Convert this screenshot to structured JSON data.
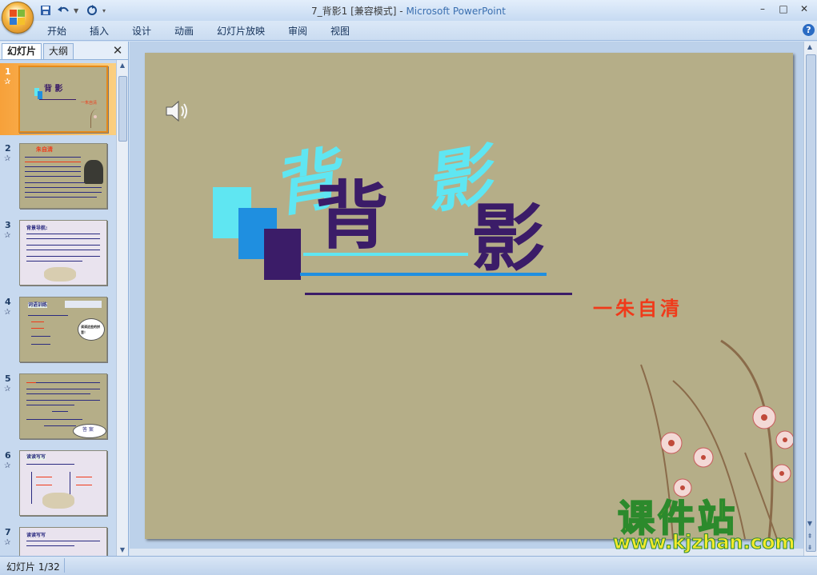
{
  "window": {
    "title_doc": "7_背影1 [兼容模式] - ",
    "title_app": "Microsoft PowerPoint",
    "controls": {
      "minimize": "–",
      "maximize": "□",
      "close": "✕"
    }
  },
  "quick_access": {
    "save_icon": "save-icon",
    "undo_icon": "undo-icon",
    "redo_icon": "redo-icon"
  },
  "ribbon": {
    "tabs": [
      "开始",
      "插入",
      "设计",
      "动画",
      "幻灯片放映",
      "审阅",
      "视图"
    ],
    "help": "?"
  },
  "left_pane": {
    "tabs": {
      "slides": "幻灯片",
      "outline": "大纲"
    },
    "close": "✕",
    "thumbnails": [
      {
        "num": "1"
      },
      {
        "num": "2"
      },
      {
        "num": "3"
      },
      {
        "num": "4"
      },
      {
        "num": "5"
      },
      {
        "num": "6"
      },
      {
        "num": "7"
      }
    ],
    "thumb_text": {
      "t1_title": "背 影",
      "t1_author": "一朱自清",
      "t2_title": "朱自清",
      "t3_title": "背景导航:",
      "t4_title": "词语训练",
      "t4_bubble": "读读这些的拼音！",
      "t5_bubble": "答 案",
      "t6_title": "读读写写",
      "t7_title": "读读写写"
    }
  },
  "slide": {
    "title_chars": [
      "背",
      "影"
    ],
    "author": "一朱自清",
    "audio_icon": "speaker-icon"
  },
  "watermark": {
    "big": "课件站",
    "url": "www.kjzhan.com"
  },
  "status": {
    "slide_counter": "幻灯片 1/32"
  },
  "colors": {
    "slide_bg": "#b5ae88",
    "title_purple": "#3b1c68",
    "title_cyan": "#5fe6f2",
    "accent_blue": "#1f8fe0",
    "author_red": "#f03a1a"
  }
}
